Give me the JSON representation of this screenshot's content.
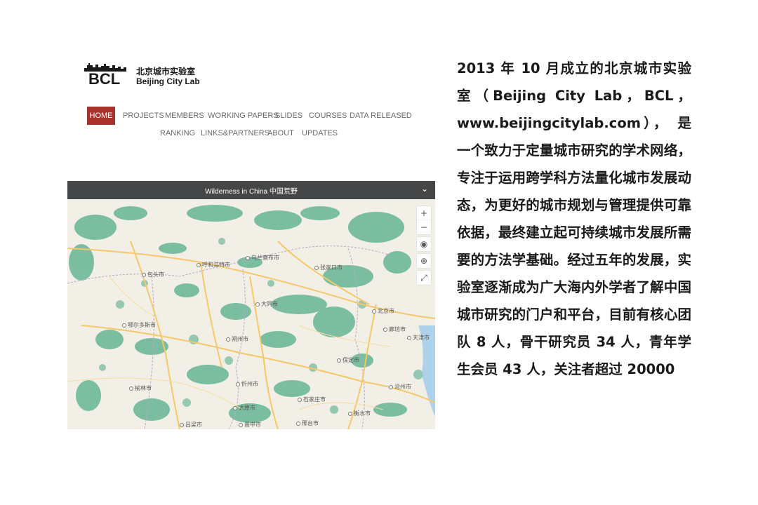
{
  "logo": {
    "abbr": "BCL",
    "name_cn": "北京城市实验室",
    "name_en": "Beijing City Lab"
  },
  "nav": {
    "row1": [
      "HOME",
      "PROJECTS",
      "MEMBERS",
      "WORKING PAPERS",
      "SLIDES",
      "COURSES",
      "DATA RELEASED"
    ],
    "row2": [
      "RANKING",
      "LINKS&PARTNERS",
      "ABOUT",
      "UPDATES"
    ],
    "active": "HOME",
    "active_color": "#a8332d"
  },
  "map": {
    "title": "Wilderness in China 中国荒野",
    "controls": [
      "zoom-in",
      "zoom-out",
      "locate",
      "globe",
      "fullscreen"
    ],
    "cities": [
      "包头市",
      "呼和浩特市",
      "乌兰察布市",
      "张家口市",
      "北京市",
      "大同市",
      "廊坊市",
      "鄂尔多斯市",
      "天津市",
      "朔州市",
      "保定市",
      "忻州市",
      "沧州市",
      "榆林市",
      "太原市",
      "石家庄市",
      "衡水市",
      "吕梁市",
      "晋中市",
      "邢台市"
    ],
    "colors": {
      "land": "#f2efe6",
      "forest": "#6fb89a",
      "road": "#f5c86a",
      "water": "#9cc9ee"
    }
  },
  "paragraph": "2013 年 10 月成立的北京城市实验室（Beijing City Lab，BCL，www.beijingcitylab.com）， 是一个致力于定量城市研究的学术网络，专注于运用跨学科方法量化城市发展动态，为更好的城市规划与管理提供可靠依据，最终建立起可持续城市发展所需要的方法学基础。经过五年的发展，实验室逐渐成为广大海内外学者了解中国城市研究的门户和平台，目前有核心团队 8 人，骨干研究员 34 人，青年学生会员 43 人，关注者超过 20000"
}
